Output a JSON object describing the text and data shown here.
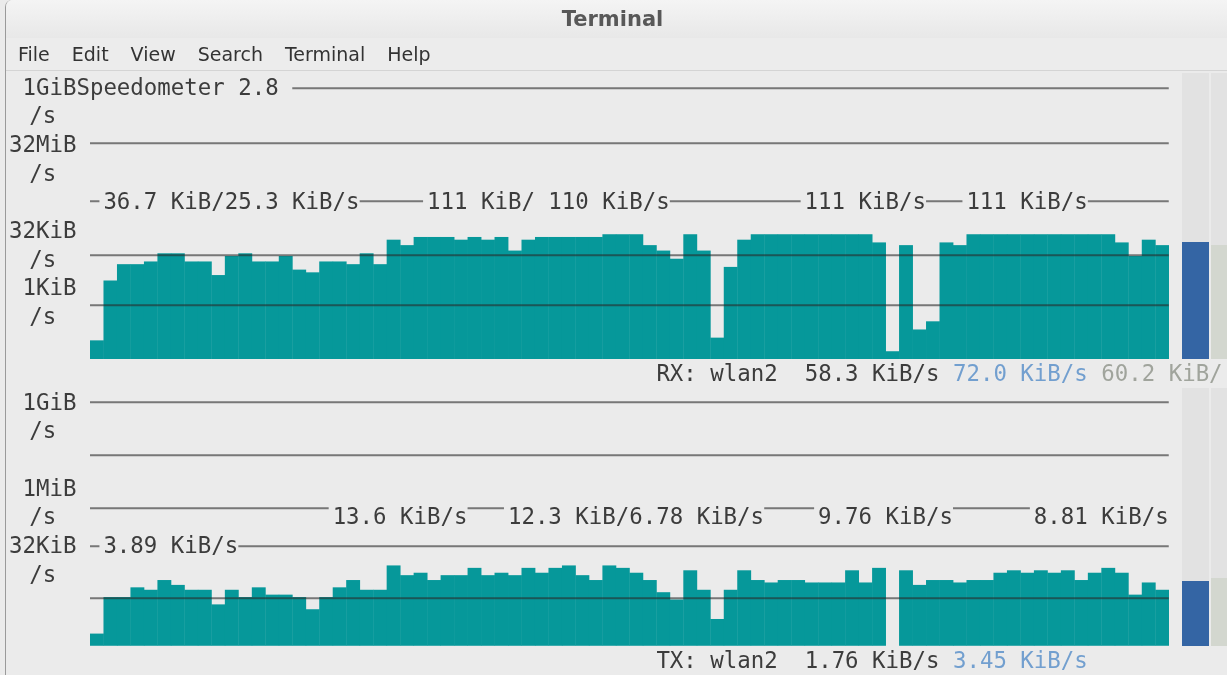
{
  "window": {
    "title": "Terminal"
  },
  "menu": [
    "File",
    "Edit",
    "View",
    "Search",
    "Terminal",
    "Help"
  ],
  "panels": [
    {
      "title": "Speedometer 2.8",
      "axis_labels": [
        "1GiB\n/s",
        "32MiB\n/s",
        "32KiB\n/s",
        "1KiB\n/s"
      ],
      "rates": [
        "36.7 KiB/25.3 KiB/s",
        "111 KiB/ 110 KiB/s",
        "111 KiB/s",
        "111 KiB/s"
      ],
      "meters": [
        {
          "color": "#3465a4",
          "level": 0.41
        },
        {
          "color": "#d3d7cf",
          "level": 0.4
        }
      ],
      "legend": {
        "interface": "RX: wlan2",
        "readings": [
          {
            "text": "58.3 KiB/s",
            "color": "#3c3c3c"
          },
          {
            "text": "72.0 KiB/s",
            "color": "#729fcf"
          },
          {
            "text": "60.2 KiB/",
            "color": "#a0a49c"
          }
        ]
      }
    },
    {
      "axis_labels": [
        "1GiB\n/s",
        "1MiB\n/s",
        "32KiB\n/s"
      ],
      "rates": [
        "13.6 KiB/s",
        "12.3 KiB/6.78 KiB/s",
        "9.76 KiB/s",
        "8.81 KiB/s",
        "3.89 KiB/s"
      ],
      "meters": [
        {
          "color": "#3465a4",
          "level": 0.25
        },
        {
          "color": "#d3d7cf",
          "level": 0.26
        }
      ],
      "legend": {
        "interface": "TX: wlan2",
        "readings": [
          {
            "text": "1.76 KiB/s",
            "color": "#3c3c3c"
          },
          {
            "text": "3.45 KiB/s",
            "color": "#729fcf"
          }
        ]
      }
    }
  ]
}
